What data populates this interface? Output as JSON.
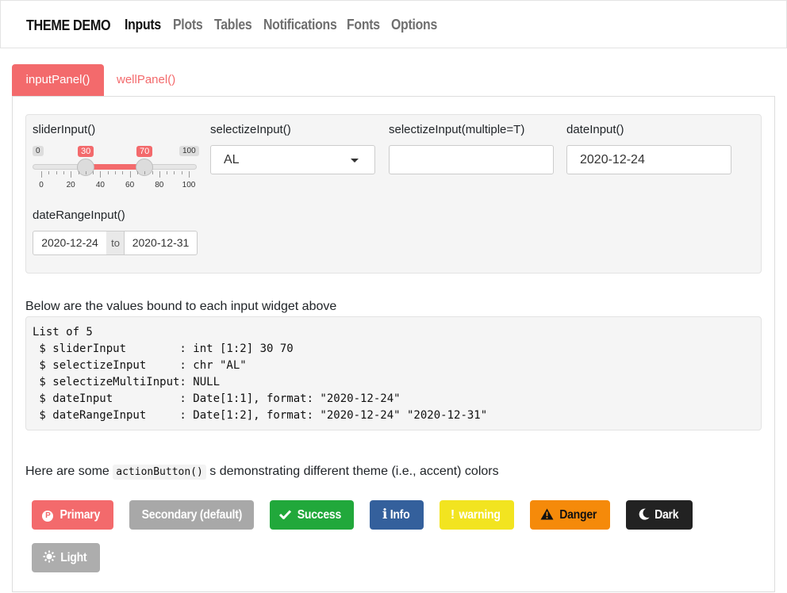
{
  "navbar": {
    "brand": "THEME DEMO",
    "items": [
      "Inputs",
      "Plots",
      "Tables",
      "Notifications",
      "Fonts",
      "Options"
    ],
    "active": "Inputs"
  },
  "tabs": {
    "active": "inputPanel()",
    "other": "wellPanel()"
  },
  "slider": {
    "label": "sliderInput()",
    "min": "0",
    "max": "100",
    "low": "30",
    "high": "70",
    "ticks": [
      "0",
      "20",
      "40",
      "60",
      "80",
      "100"
    ]
  },
  "selectize": {
    "label": "selectizeInput()",
    "value": "AL"
  },
  "selectize_multi": {
    "label": "selectizeInput(multiple=T)",
    "value": ""
  },
  "date_input": {
    "label": "dateInput()",
    "value": "2020-12-24"
  },
  "date_range": {
    "label": "dateRangeInput()",
    "start": "2020-12-24",
    "separator": "to",
    "end": "2020-12-31"
  },
  "values_section": {
    "description": "Below are the values bound to each input widget above",
    "output": "List of 5\n $ sliderInput        : int [1:2] 30 70\n $ selectizeInput     : chr \"AL\"\n $ selectizeMultiInput: NULL\n $ dateInput          : Date[1:1], format: \"2020-12-24\"\n $ dateRangeInput     : Date[1:2], format: \"2020-12-24\" \"2020-12-31\""
  },
  "buttons_section": {
    "intro_before": "Here are some ",
    "intro_code": "actionButton()",
    "intro_after": " s demonstrating different theme (i.e., accent) colors"
  },
  "buttons": {
    "primary": {
      "label": "Primary",
      "icon": "p-circle-icon",
      "color": "#f36a6c"
    },
    "secondary": {
      "label": "Secondary (default)",
      "color": "#a8a8a8"
    },
    "success": {
      "label": "Success",
      "icon": "check-icon",
      "color": "#21a83b"
    },
    "info": {
      "label": "Info",
      "icon": "info-icon",
      "color": "#34609c"
    },
    "warning": {
      "label": "warning",
      "icon": "exclamation-icon",
      "color": "#f2e420"
    },
    "danger": {
      "label": "Danger",
      "icon": "warning-triangle-icon",
      "color": "#f58a0a"
    },
    "dark": {
      "label": "Dark",
      "icon": "moon-icon",
      "color": "#222222"
    },
    "light": {
      "label": "Light",
      "icon": "sun-icon",
      "color": "#adadad"
    }
  },
  "colors": {
    "accent": "#f36a6c"
  }
}
